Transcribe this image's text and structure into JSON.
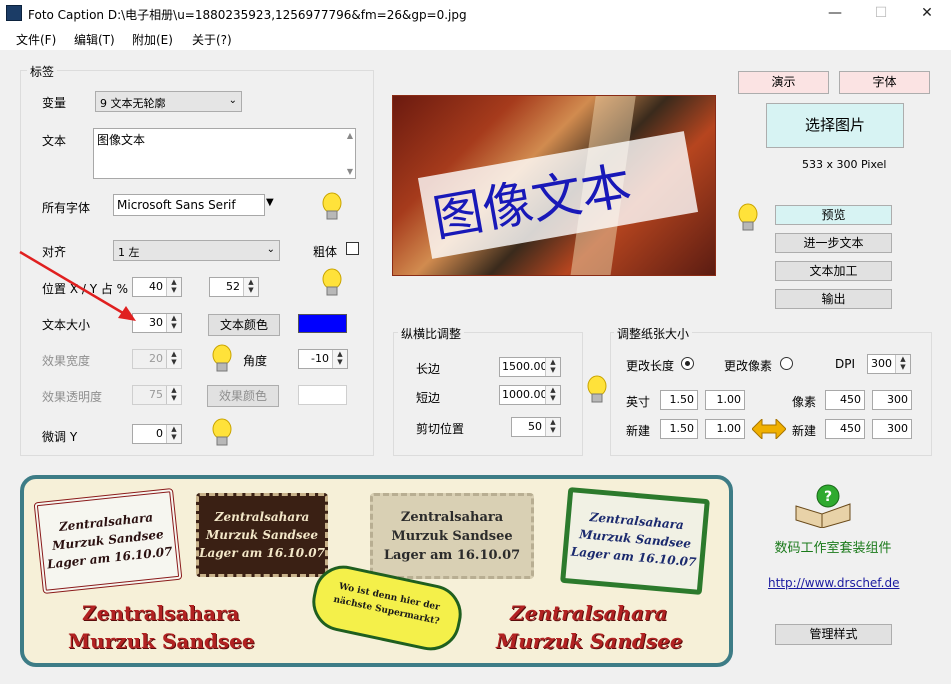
{
  "window": {
    "title": "Foto Caption D:\\电子相册\\u=1880235923,1256977796&fm=26&gp=0.jpg",
    "minimize": "—",
    "maximize": "☐",
    "close": "✕"
  },
  "menu": [
    "文件(F)",
    "编辑(T)",
    "附加(E)",
    "关于(?)"
  ],
  "label_group": {
    "title": "标签",
    "variant_label": "变量",
    "variant_value": "9 文本无轮廓",
    "text_label": "文本",
    "text_value": "图像文本",
    "font_label": "所有字体",
    "font_value": "Microsoft Sans Serif",
    "align_label": "对齐",
    "align_value": "1 左",
    "bold_label": "粗体",
    "position_label": "位置 X / Y 占 %",
    "pos_x": "40",
    "pos_y": "52",
    "size_label": "文本大小",
    "size_value": "30",
    "text_color_button": "文本颜色",
    "text_color": "#0000ff",
    "effect_width_label": "效果宽度",
    "effect_width_value": "20",
    "angle_label": "角度",
    "angle_value": "-10",
    "effect_alpha_label": "效果透明度",
    "effect_alpha_value": "75",
    "effect_color_button": "效果颜色",
    "fine_y_label": "微调 Y",
    "fine_y_value": "0"
  },
  "preview": {
    "caption": "图像文本"
  },
  "right_panel": {
    "demo_button": "演示",
    "font_button": "字体",
    "select_image_button": "选择图片",
    "image_size": "533 x 300 Pixel",
    "preview_button": "预览",
    "more_text_button": "进一步文本",
    "text_process_button": "文本加工",
    "output_button": "输出"
  },
  "aspect_group": {
    "title": "纵横比调整",
    "long_label": "长边",
    "long_value": "1500.00",
    "short_label": "短边",
    "short_value": "1000.00",
    "crop_label": "剪切位置",
    "crop_value": "50"
  },
  "paper_group": {
    "title": "调整纸张大小",
    "change_length_label": "更改长度",
    "change_pixel_label": "更改像素",
    "dpi_label": "DPI",
    "dpi_value": "300",
    "inch_label": "英寸",
    "inch_w": "1.50",
    "inch_h": "1.00",
    "pixel_label": "像素",
    "pixel_w": "450",
    "pixel_h": "300",
    "new_label": "新建",
    "new_inch_w": "1.50",
    "new_inch_h": "1.00",
    "new_pixel_label": "新建",
    "new_pixel_w": "450",
    "new_pixel_h": "300"
  },
  "banner": {
    "line1": "Zentralsahara",
    "line2": "Murzuk Sandsee",
    "line3": "Lager am 16.10.07",
    "bubble": "Wo ist denn hier der nächste Supermarkt?"
  },
  "footer": {
    "suite_label": "数码工作室套装组件",
    "url": "http://www.drschef.de",
    "manage_button": "管理样式"
  }
}
